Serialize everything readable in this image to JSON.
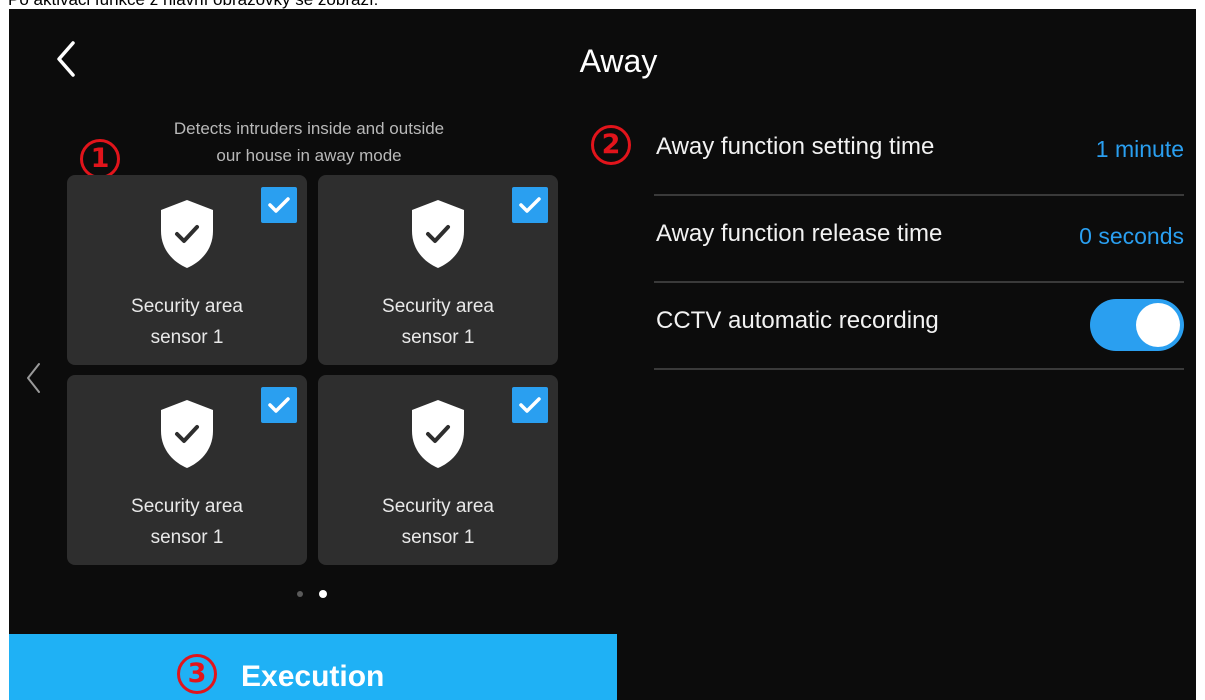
{
  "caption": "Po aktivaci funkce z hlavní obrazovky se zobrazí:",
  "header": {
    "title": "Away",
    "back_icon": "back-arrow-icon"
  },
  "colors": {
    "accent": "#2a9ff0",
    "execution_bar": "#1fb1f5",
    "annotation": "#e2141b",
    "background": "#0c0c0c",
    "tile": "#2e2e2e"
  },
  "area_panel": {
    "description": "Detects intruders inside and outside\nour house in away mode",
    "tiles": [
      {
        "label": "Security area\nsensor 1",
        "checked": true,
        "icon": "shield-check-icon"
      },
      {
        "label": "Security area\nsensor 1",
        "checked": true,
        "icon": "shield-check-icon"
      },
      {
        "label": "Security area\nsensor 1",
        "checked": true,
        "icon": "shield-check-icon"
      },
      {
        "label": "Security area\nsensor 1",
        "checked": true,
        "icon": "shield-check-icon"
      }
    ],
    "pagination": {
      "pages": 2,
      "current": 2
    }
  },
  "settings": {
    "setting_time": {
      "label": "Away function setting time",
      "value": "1 minute"
    },
    "release_time": {
      "label": "Away function release time",
      "value": "0 seconds"
    },
    "cctv_recording": {
      "label": "CCTV automatic recording",
      "enabled": true
    }
  },
  "execution": {
    "label": "Execution"
  },
  "annotations": [
    "1",
    "2",
    "3"
  ]
}
